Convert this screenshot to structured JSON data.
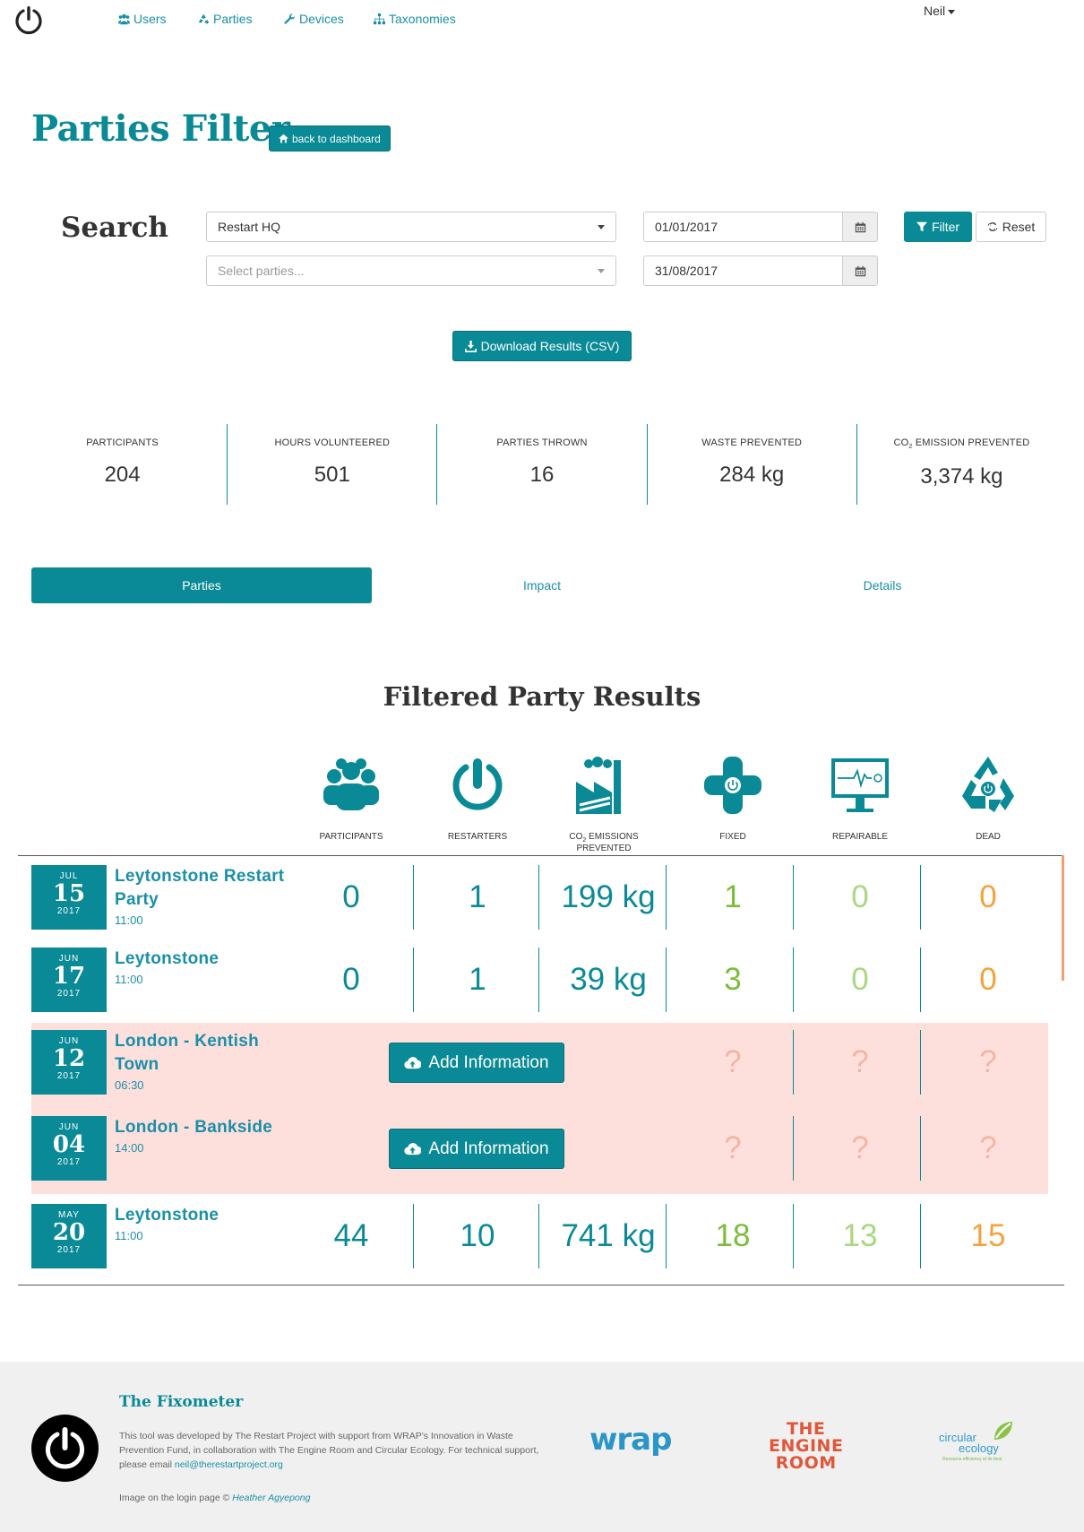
{
  "nav": {
    "links": [
      {
        "label": "Users",
        "icon": "users-icon"
      },
      {
        "label": "Parties",
        "icon": "recycle-icon"
      },
      {
        "label": "Devices",
        "icon": "wrench-icon"
      },
      {
        "label": "Taxonomies",
        "icon": "sitemap-icon"
      }
    ],
    "user": "Neil"
  },
  "header": {
    "title": "Parties Filter",
    "back_label": "back to dashboard"
  },
  "search": {
    "label": "Search",
    "group_value": "Restart HQ",
    "parties_placeholder": "Select parties...",
    "date_from": "01/01/2017",
    "date_to": "31/08/2017",
    "filter_label": "Filter",
    "reset_label": "Reset",
    "download_label": "Download Results (CSV)"
  },
  "stats": [
    {
      "label": "PARTICIPANTS",
      "value": "204"
    },
    {
      "label": "HOURS VOLUNTEERED",
      "value": "501"
    },
    {
      "label": "PARTIES THROWN",
      "value": "16"
    },
    {
      "label": "WASTE PREVENTED",
      "value": "284 kg"
    },
    {
      "label_pre": "CO",
      "label_sub": "2",
      "label_post": " EMISSION PREVENTED",
      "value": "3,374 kg"
    }
  ],
  "tabs": [
    "Parties",
    "Impact",
    "Details"
  ],
  "results": {
    "title": "Filtered Party Results",
    "columns": [
      {
        "label": "PARTICIPANTS",
        "icon": "participants-icon"
      },
      {
        "label": "RESTARTERS",
        "icon": "restarters-icon"
      },
      {
        "label_pre": "CO",
        "label_sub": "2",
        "label_post": " EMISSIONS PREVENTED",
        "icon": "factory-icon"
      },
      {
        "label": "FIXED",
        "icon": "fixed-icon"
      },
      {
        "label": "REPAIRABLE",
        "icon": "repairable-icon"
      },
      {
        "label": "DEAD",
        "icon": "dead-icon"
      }
    ],
    "add_label": "Add Information",
    "unknown": "?",
    "rows": [
      {
        "month": "JUL",
        "day": "15",
        "year": "2017",
        "name": "Leytonstone Restart Party",
        "time": "11:00",
        "participants": "0",
        "restarters": "1",
        "co2": "199 kg",
        "fixed": "1",
        "repairable": "0",
        "dead": "0"
      },
      {
        "month": "JUN",
        "day": "17",
        "year": "2017",
        "name": "Leytonstone",
        "time": "11:00",
        "participants": "0",
        "restarters": "1",
        "co2": "39 kg",
        "fixed": "3",
        "repairable": "0",
        "dead": "0"
      },
      {
        "month": "JUN",
        "day": "12",
        "year": "2017",
        "name": "London - Kentish Town",
        "time": "06:30"
      },
      {
        "month": "JUN",
        "day": "04",
        "year": "2017",
        "name": "London - Bankside",
        "time": "14:00"
      },
      {
        "month": "MAY",
        "day": "20",
        "year": "2017",
        "name": "Leytonstone",
        "time": "11:00",
        "participants": "44",
        "restarters": "10",
        "co2": "741 kg",
        "fixed": "18",
        "repairable": "13",
        "dead": "15"
      }
    ]
  },
  "footer": {
    "title": "The Fixometer",
    "text": "This tool was developed by The Restart Project with support from WRAP's Innovation in Waste Prevention Fund, in collaboration with The Engine Room and Circular Ecology. For technical support, please email ",
    "email": "neil@therestartproject.org",
    "credit_pre": "Image on the login page © ",
    "credit_name": "Heather Agyepong",
    "wrap_logo": "wrap",
    "engine_logo": [
      "THE",
      "ENGINE",
      "ROOM"
    ],
    "ce_logo": [
      "circular",
      "ecology",
      "Resource efficiency at its best"
    ]
  }
}
